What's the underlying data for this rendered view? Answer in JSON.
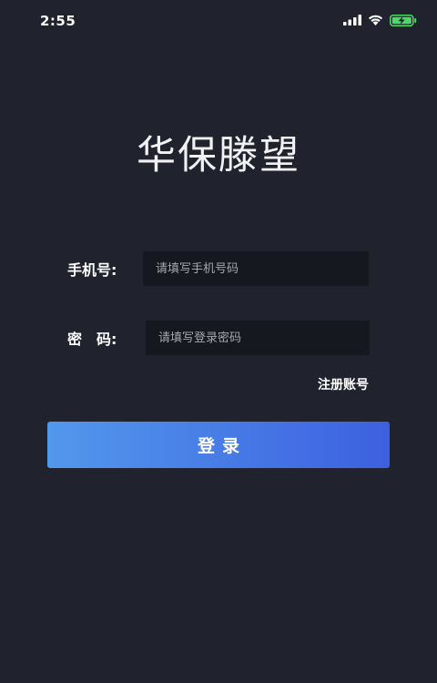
{
  "status_bar": {
    "time": "2:55",
    "icons": [
      "signal-icon",
      "wifi-icon",
      "battery-charging-icon"
    ],
    "battery_color": "#4cd964"
  },
  "app": {
    "title": "华保滕望"
  },
  "form": {
    "phone_label": "手机号:",
    "phone_placeholder": "请填写手机号码",
    "password_label": "密　码:",
    "password_placeholder": "请填写登录密码"
  },
  "actions": {
    "register_label": "注册账号",
    "login_label": "登录"
  },
  "colors": {
    "background": "#20232e",
    "input_background": "#161820",
    "button_gradient_start": "#5298ec",
    "button_gradient_end": "#3d60e0"
  }
}
